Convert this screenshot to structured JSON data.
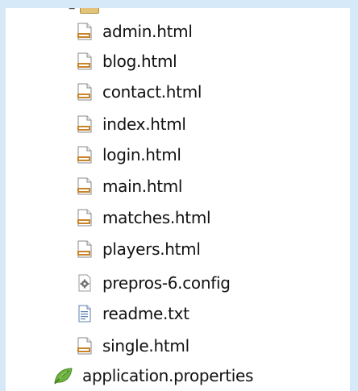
{
  "tree": {
    "parent_folder": {
      "label": "",
      "icon": "folder-icon"
    },
    "children": [
      {
        "label": "admin.html",
        "icon": "html-file-icon"
      },
      {
        "label": "blog.html",
        "icon": "html-file-icon"
      },
      {
        "label": "contact.html",
        "icon": "html-file-icon"
      },
      {
        "label": "index.html",
        "icon": "html-file-icon"
      },
      {
        "label": "login.html",
        "icon": "html-file-icon"
      },
      {
        "label": "main.html",
        "icon": "html-file-icon"
      },
      {
        "label": "matches.html",
        "icon": "html-file-icon"
      },
      {
        "label": "players.html",
        "icon": "html-file-icon"
      },
      {
        "label": "prepros-6.config",
        "icon": "config-file-icon"
      },
      {
        "label": "readme.txt",
        "icon": "text-file-icon"
      },
      {
        "label": "single.html",
        "icon": "html-file-icon"
      }
    ],
    "top_level": [
      {
        "label": "application.properties",
        "icon": "spring-leaf-icon"
      }
    ]
  },
  "colors": {
    "frame": "#d6e9f8",
    "html_icon_accent": "#c8842a",
    "leaf_green": "#6db33f"
  }
}
